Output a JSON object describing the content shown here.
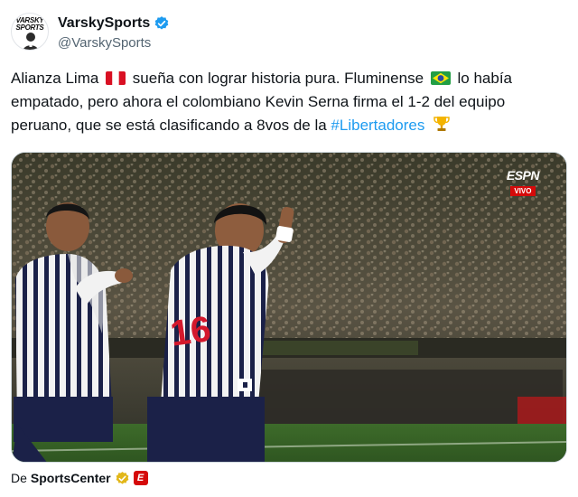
{
  "author": {
    "display_name": "VarskySports",
    "handle": "@VarskySports",
    "avatar_text_line1": "VARSKY",
    "avatar_text_line2": "SPORTS",
    "verified_color": "#1d9bf0"
  },
  "tweet": {
    "line1_a": "Alianza Lima",
    "line1_b": "sueña con lograr historia pura. Fluminense",
    "line1_c": "lo había",
    "line2": "empatado, pero ahora el colombiano Kevin Serna firma el 1-2 del equipo",
    "line3_a": "peruano, que se está clasificando a 8vos de la",
    "hashtag": "#Libertadores",
    "flag_peru_icon": "peru-flag-icon",
    "flag_brazil_icon": "brazil-flag-icon",
    "trophy_icon": "trophy-icon"
  },
  "media": {
    "broadcaster": "ESPN",
    "live_badge": "VIVO",
    "jersey_number": "16"
  },
  "source": {
    "prefix": "De",
    "name": "SportsCenter",
    "badge_color": "#e2b719",
    "logo_letter": "E"
  },
  "colors": {
    "link": "#1d9bf0",
    "text": "#0f1419",
    "muted": "#536471"
  }
}
